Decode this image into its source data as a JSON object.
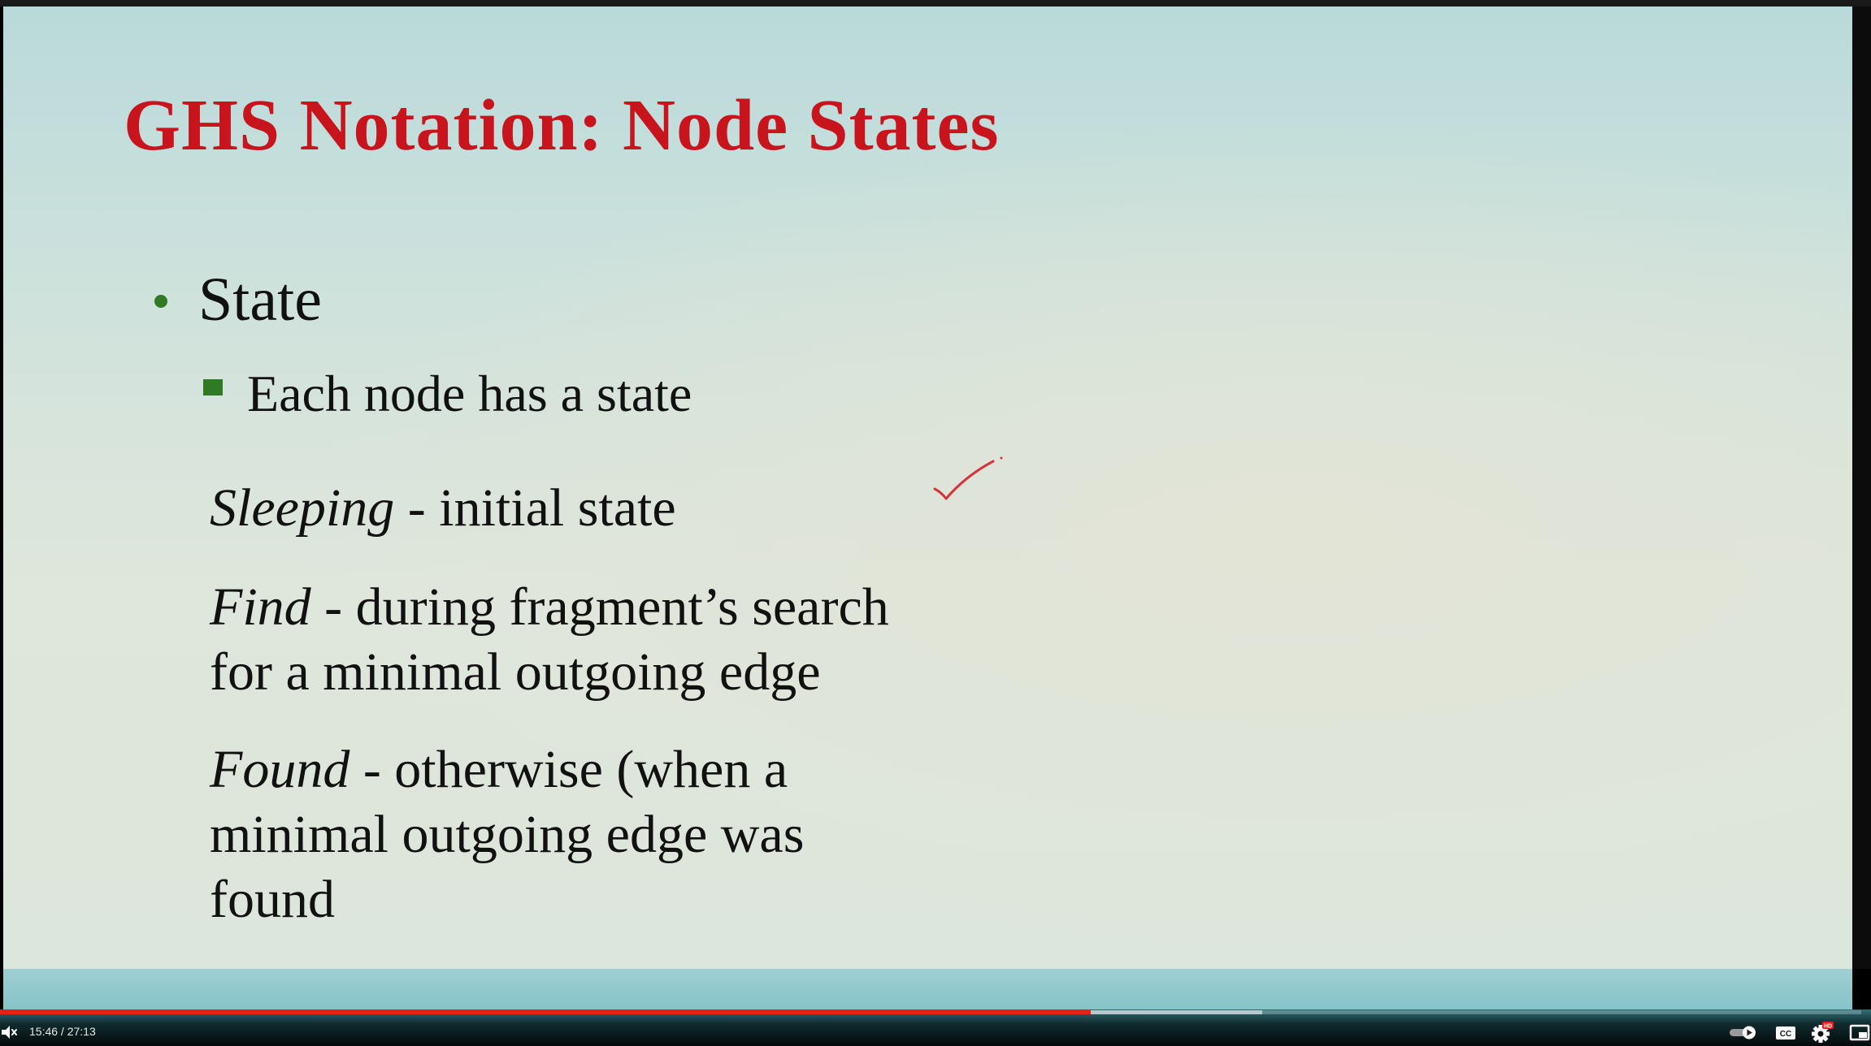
{
  "slide": {
    "title": "GHS Notation: Node States",
    "bullet": "State",
    "sub_bullet": "Each node has a state",
    "states": [
      {
        "name": "Sleeping",
        "description": " - initial state"
      },
      {
        "name": "Find",
        "description_line1": " - during fragment’s search",
        "description_line2": "for a minimal outgoing edge"
      },
      {
        "name": "Found",
        "description_line1": " - otherwise (when a",
        "description_line2": "minimal outgoing edge was",
        "description_line3": "found"
      }
    ]
  },
  "player": {
    "current_time": "15:46",
    "separator": " / ",
    "duration": "27:13",
    "progress_fraction": 0.586,
    "buffer_fraction": 0.678,
    "colors": {
      "played": "#e62117",
      "title": "#c8141c",
      "bullet": "#2f7a22"
    },
    "icons": [
      "mute-icon",
      "autoplay-icon",
      "captions-icon",
      "settings-icon",
      "hd-badge",
      "miniplayer-icon"
    ],
    "hd_badge": "HD",
    "captions_label": "CC"
  }
}
